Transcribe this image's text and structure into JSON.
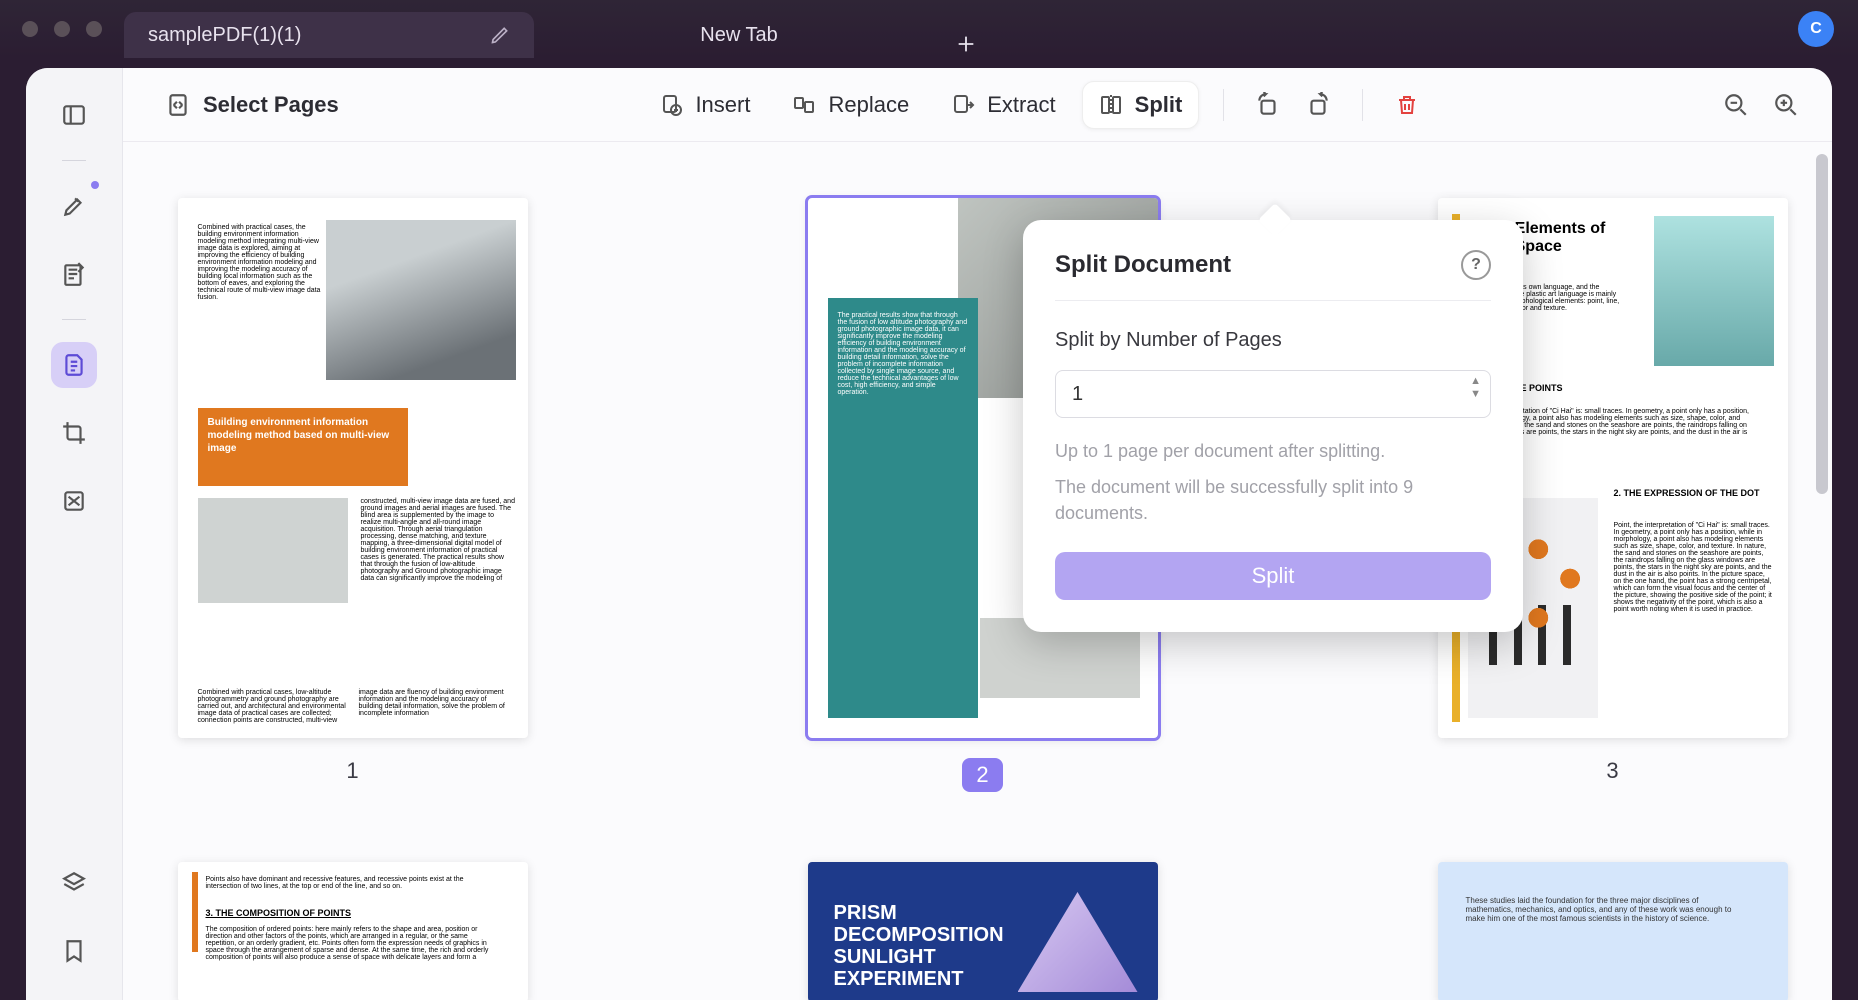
{
  "window": {
    "tabs": [
      {
        "label": "samplePDF(1)(1)",
        "active": true
      },
      {
        "label": "New Tab",
        "active": false
      }
    ],
    "avatar_initial": "C"
  },
  "toolbar": {
    "select_pages": "Select Pages",
    "insert": "Insert",
    "replace": "Replace",
    "extract": "Extract",
    "split": "Split"
  },
  "popover": {
    "title": "Split Document",
    "field_label": "Split by Number of Pages",
    "value": "1",
    "hint1": "Up to 1 page per document after splitting.",
    "hint2": "The document will be successfully split into 9 documents.",
    "action": "Split"
  },
  "thumbnails": {
    "count": 6,
    "selected": 2,
    "labels": [
      "1",
      "2",
      "3"
    ],
    "page1_title": "Building environment information modeling method based on multi-view image",
    "page3_title": "Basic Elements of Plane Space",
    "page3_sub1": "1. KNOW THE POINTS",
    "page3_sub2": "2. THE EXPRESSION OF THE DOT",
    "page4_sub": "3. THE COMPOSITION OF POINTS",
    "page5_title": "PRISM DECOMPOSITION SUNLIGHT EXPERIMENT"
  }
}
